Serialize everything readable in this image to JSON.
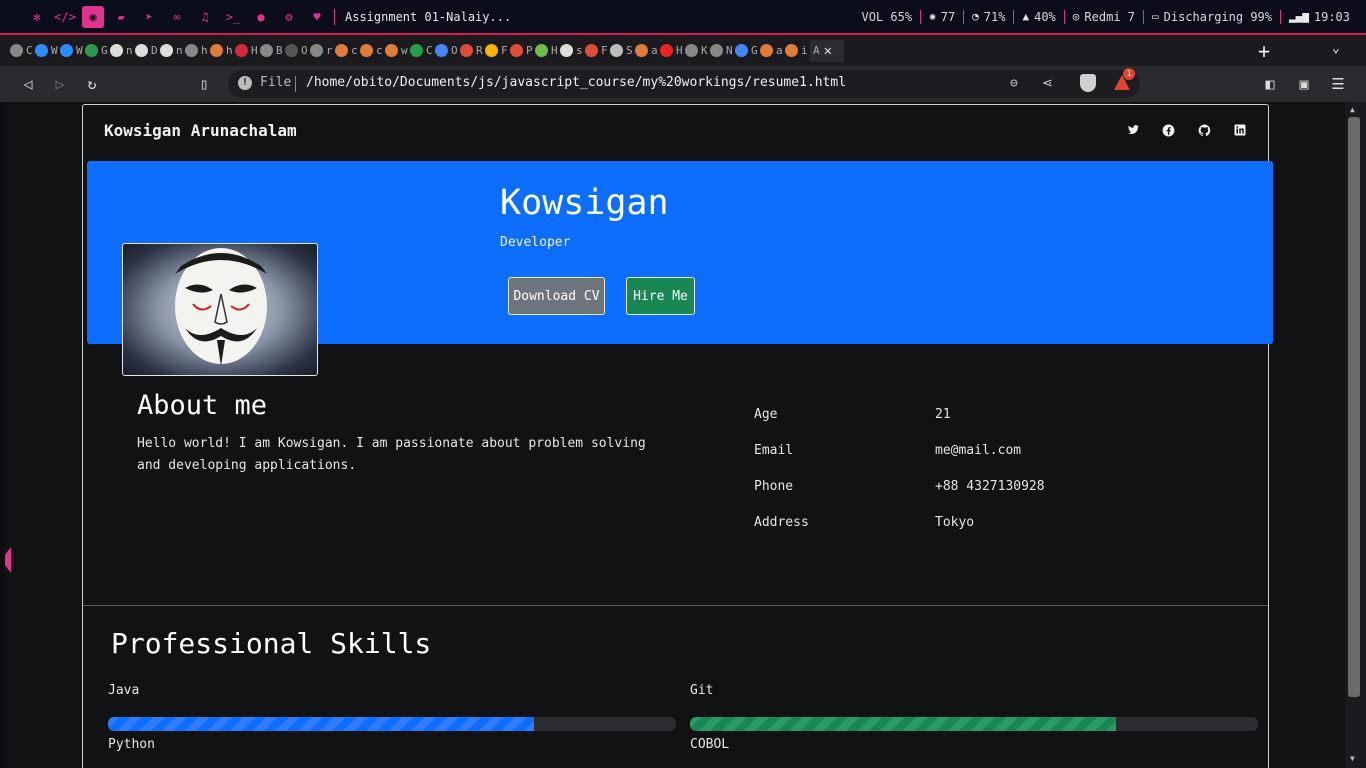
{
  "topbar": {
    "window_title": "Assignment 01-Nalaiy...",
    "volume": "VOL 65%",
    "cpu": "77",
    "memory": "71%",
    "disk": "40%",
    "network": "Redmi 7",
    "battery": "Discharging 99%",
    "time": "19:03"
  },
  "tabs": {
    "letters": [
      "C",
      "W",
      "W",
      "G",
      "n",
      "D",
      "n",
      "h",
      "h",
      "H",
      "B",
      "O",
      "r",
      "c",
      "c",
      "w",
      "C",
      "O",
      "R",
      "F",
      "P",
      "H",
      "s",
      "F",
      "S",
      "a",
      "H",
      "K",
      "N",
      "G",
      "a",
      "i"
    ],
    "active_label": "A",
    "close": "✕",
    "new_tab": "+"
  },
  "address": {
    "scheme": "File",
    "url": "/home/obito/Documents/js/javascript_course/my%20workings/resume1.html",
    "rewards_count": "1"
  },
  "page": {
    "brand": "Kowsigan Arunachalam",
    "social_icons": [
      "twitter-icon",
      "facebook-icon",
      "github-icon",
      "linkedin-icon"
    ],
    "hero": {
      "name": "Kowsigan",
      "role": "Developer",
      "download_cv": "Download CV",
      "hire_me": "Hire Me"
    },
    "about": {
      "title": "About me",
      "text": "Hello world! I am Kowsigan. I am passionate about problem solving and developing applications."
    },
    "info": [
      {
        "key": "Age",
        "value": "21"
      },
      {
        "key": "Email",
        "value": "me@mail.com"
      },
      {
        "key": "Phone",
        "value": "+88 4327130928"
      },
      {
        "key": "Address",
        "value": "Tokyo"
      }
    ],
    "skills": {
      "title": "Professional Skills",
      "items": [
        {
          "name": "Java",
          "level": 0.75,
          "color": "#0d6efd"
        },
        {
          "name": "Git",
          "level": 0.75,
          "color": "#198754"
        },
        {
          "name": "Python"
        },
        {
          "name": "COBOL"
        }
      ]
    }
  }
}
